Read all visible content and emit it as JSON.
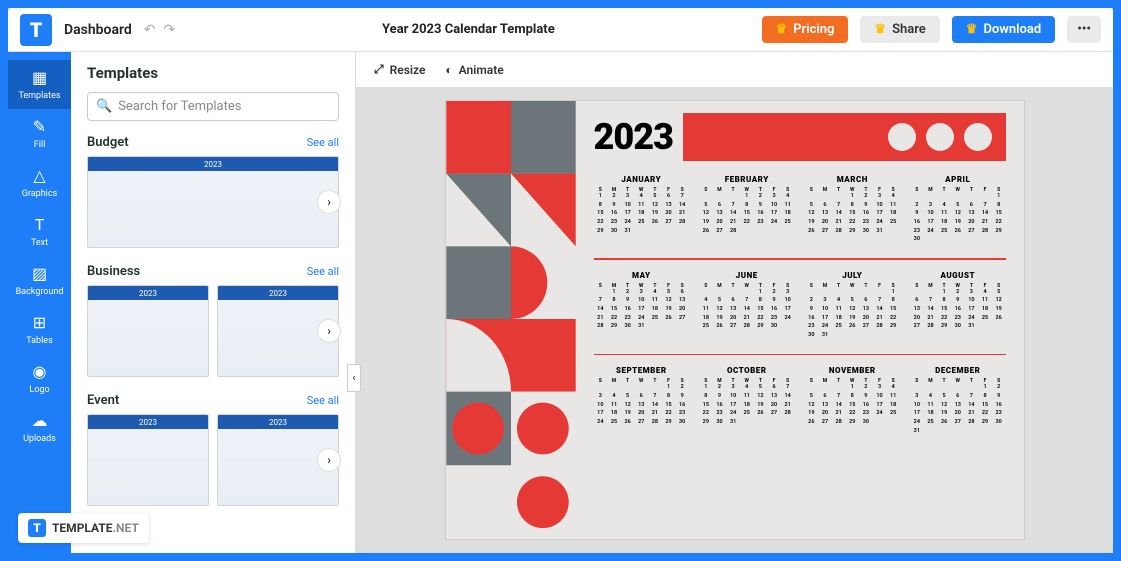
{
  "header": {
    "dashboard": "Dashboard",
    "title": "Year 2023 Calendar Template",
    "pricing": "Pricing",
    "share": "Share",
    "download": "Download"
  },
  "sidebar": {
    "items": [
      {
        "label": "Templates",
        "icon": "▦"
      },
      {
        "label": "Fill",
        "icon": "✎"
      },
      {
        "label": "Graphics",
        "icon": "△"
      },
      {
        "label": "Text",
        "icon": "T"
      },
      {
        "label": "Background",
        "icon": "▨"
      },
      {
        "label": "Tables",
        "icon": "⊞"
      },
      {
        "label": "Logo",
        "icon": "◉"
      },
      {
        "label": "Uploads",
        "icon": "☁"
      }
    ]
  },
  "panel": {
    "title": "Templates",
    "search_placeholder": "Search for Templates",
    "categories": [
      {
        "name": "Budget",
        "see": "See all",
        "thumb_label": "2023"
      },
      {
        "name": "Business",
        "see": "See all",
        "thumb_label": "2023"
      },
      {
        "name": "Event",
        "see": "See all",
        "thumb_label": "2023"
      }
    ]
  },
  "toolbar": {
    "resize": "Resize",
    "animate": "Animate"
  },
  "calendar": {
    "year": "2023",
    "dow": [
      "S",
      "M",
      "T",
      "W",
      "T",
      "F",
      "S"
    ],
    "months": [
      {
        "name": "JANUARY",
        "start": 0,
        "days": 31
      },
      {
        "name": "FEBRUARY",
        "start": 3,
        "days": 28
      },
      {
        "name": "MARCH",
        "start": 3,
        "days": 31
      },
      {
        "name": "APRIL",
        "start": 6,
        "days": 30
      },
      {
        "name": "MAY",
        "start": 1,
        "days": 31
      },
      {
        "name": "JUNE",
        "start": 4,
        "days": 30
      },
      {
        "name": "JULY",
        "start": 6,
        "days": 31
      },
      {
        "name": "AUGUST",
        "start": 2,
        "days": 31
      },
      {
        "name": "SEPTEMBER",
        "start": 5,
        "days": 30
      },
      {
        "name": "OCTOBER",
        "start": 0,
        "days": 31
      },
      {
        "name": "NOVEMBER",
        "start": 3,
        "days": 30
      },
      {
        "name": "DECEMBER",
        "start": 5,
        "days": 31
      }
    ]
  },
  "brand": {
    "name": "TEMPLATE",
    "suffix": ".NET"
  }
}
